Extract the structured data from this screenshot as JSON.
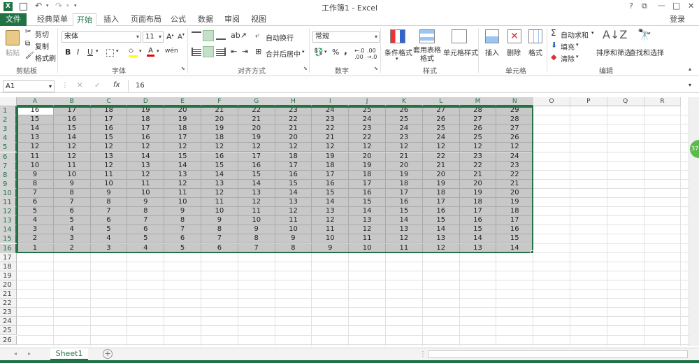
{
  "title": {
    "app": "工作簿1 - Excel",
    "help": "?",
    "restore": "⧉",
    "min": "—",
    "max": "□",
    "close": "✕",
    "login": "登录"
  },
  "tabs": [
    "文件",
    "经典菜单",
    "开始",
    "插入",
    "页面布局",
    "公式",
    "数据",
    "审阅",
    "视图"
  ],
  "ribbon": {
    "paste": "粘贴",
    "cut": "剪切",
    "copy": "复制",
    "format_painter": "格式刷",
    "clipboard": "剪贴板",
    "font_name": "宋体",
    "font_size": "11",
    "bold": "B",
    "italic": "I",
    "underline": "U",
    "font_group": "字体",
    "wrap": "自动换行",
    "merge": "合并后居中",
    "align_group": "对齐方式",
    "number_format": "常规",
    "percent": "%",
    "comma": ",",
    "number_group": "数字",
    "cond_format": "条件格式",
    "table_format": "套用表格格式",
    "cell_style": "单元格样式",
    "styles_group": "样式",
    "insert": "插入",
    "delete": "删除",
    "format": "格式",
    "cells_group": "单元格",
    "autosum": "自动求和",
    "fill": "填充",
    "clear": "清除",
    "sort": "排序和筛选",
    "find": "查找和选择",
    "edit_group": "编辑"
  },
  "formula": {
    "namebox": "A1",
    "fx": "fx",
    "value": "16",
    "cancel": "✕",
    "enter": "✓"
  },
  "columns": [
    "A",
    "B",
    "C",
    "D",
    "E",
    "F",
    "G",
    "H",
    "I",
    "J",
    "K",
    "L",
    "M",
    "N",
    "O",
    "P",
    "Q",
    "R"
  ],
  "rows": [
    "1",
    "2",
    "3",
    "4",
    "5",
    "6",
    "7",
    "8",
    "9",
    "10",
    "11",
    "12",
    "13",
    "14",
    "15",
    "16",
    "17",
    "18",
    "19",
    "20",
    "21",
    "22",
    "23",
    "24",
    "25",
    "26"
  ],
  "cells": [
    [
      16,
      17,
      18,
      19,
      20,
      21,
      22,
      23,
      24,
      25,
      26,
      27,
      28,
      29
    ],
    [
      15,
      16,
      17,
      18,
      19,
      20,
      21,
      22,
      23,
      24,
      25,
      26,
      27,
      28
    ],
    [
      14,
      15,
      16,
      17,
      18,
      19,
      20,
      21,
      22,
      23,
      24,
      25,
      26,
      27
    ],
    [
      13,
      14,
      15,
      16,
      17,
      18,
      19,
      20,
      21,
      22,
      23,
      24,
      25,
      26
    ],
    [
      12,
      12,
      12,
      12,
      12,
      12,
      12,
      12,
      12,
      12,
      12,
      12,
      12,
      12
    ],
    [
      11,
      12,
      13,
      14,
      15,
      16,
      17,
      18,
      19,
      20,
      21,
      22,
      23,
      24
    ],
    [
      10,
      11,
      12,
      13,
      14,
      15,
      16,
      17,
      18,
      19,
      20,
      21,
      22,
      23
    ],
    [
      9,
      10,
      11,
      12,
      13,
      14,
      15,
      16,
      17,
      18,
      19,
      20,
      21,
      22
    ],
    [
      8,
      9,
      10,
      11,
      12,
      13,
      14,
      15,
      16,
      17,
      18,
      19,
      20,
      21
    ],
    [
      7,
      8,
      9,
      10,
      11,
      12,
      13,
      14,
      15,
      16,
      17,
      18,
      19,
      20
    ],
    [
      6,
      7,
      8,
      9,
      10,
      11,
      12,
      13,
      14,
      15,
      16,
      17,
      18,
      19
    ],
    [
      5,
      6,
      7,
      8,
      9,
      10,
      11,
      12,
      13,
      14,
      15,
      16,
      17,
      18
    ],
    [
      4,
      5,
      6,
      7,
      8,
      9,
      10,
      11,
      12,
      13,
      14,
      15,
      16,
      17
    ],
    [
      3,
      4,
      5,
      6,
      7,
      8,
      9,
      10,
      11,
      12,
      13,
      14,
      15,
      16
    ],
    [
      2,
      3,
      4,
      5,
      6,
      7,
      8,
      9,
      10,
      11,
      12,
      13,
      14,
      15
    ],
    [
      1,
      2,
      3,
      4,
      5,
      6,
      7,
      8,
      9,
      10,
      11,
      12,
      13,
      14
    ]
  ],
  "sheet": {
    "tab": "Sheet1",
    "add": "+"
  },
  "side_badge": "37",
  "colors": {
    "accent": "#217346",
    "selection": "#c8c8c8"
  }
}
